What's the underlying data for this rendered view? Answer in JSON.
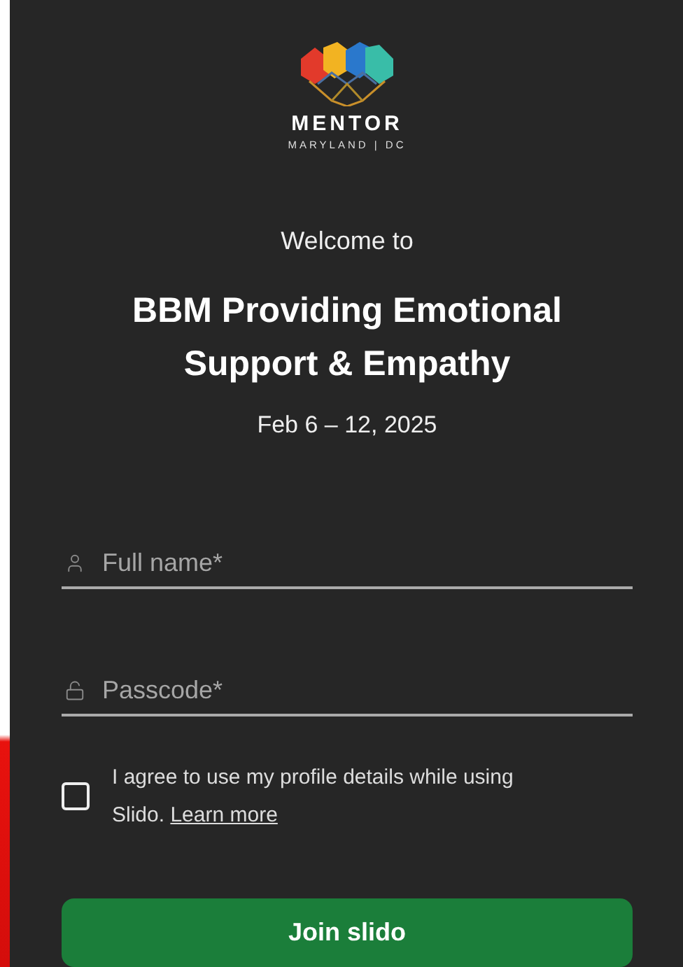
{
  "logo": {
    "name": "MENTOR",
    "subtitle": "MARYLAND | DC"
  },
  "welcome": "Welcome to",
  "title": "BBM Providing Emotional Support & Empathy",
  "date": "Feb 6 – 12, 2025",
  "fields": [
    {
      "kind": "name",
      "placeholder": "Full name*"
    },
    {
      "kind": "passcode",
      "placeholder": "Passcode*"
    }
  ],
  "consent": {
    "checked": false,
    "text": "I agree to use my profile details while using Slido.",
    "link": "Learn more"
  },
  "button": "Join slido"
}
